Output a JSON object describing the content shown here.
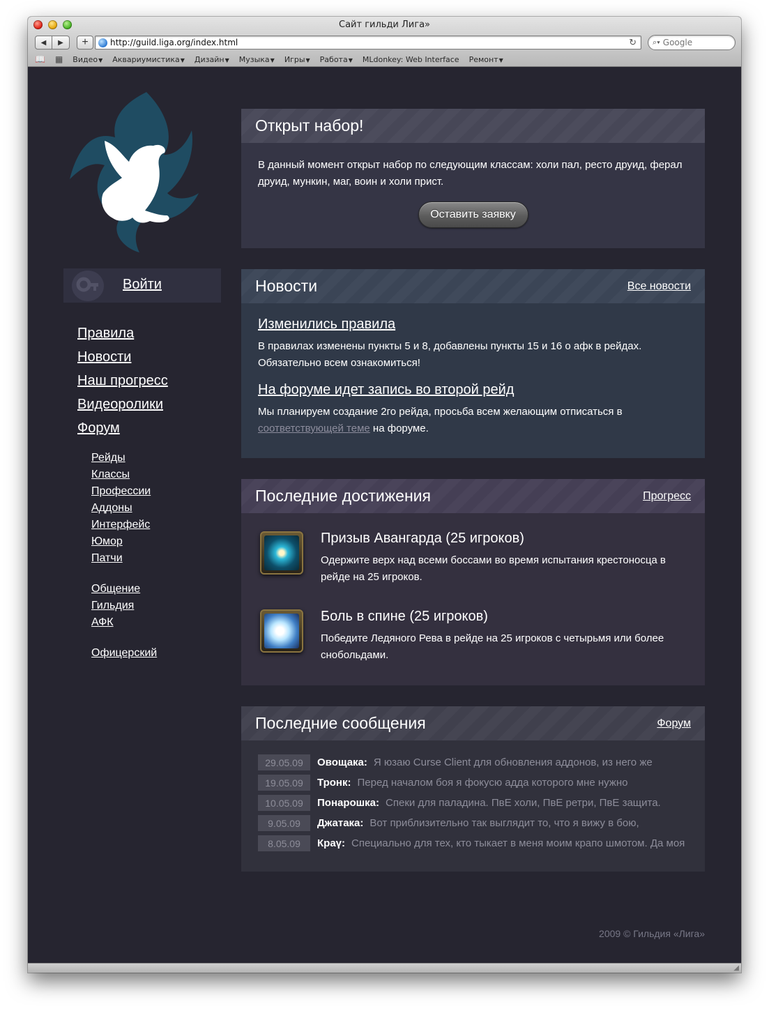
{
  "browser": {
    "window_title": "Сайт гильди Лига»",
    "url": "http://guild.liga.org/index.html",
    "search_placeholder": "Google",
    "bookmarks": [
      {
        "label": "Видео",
        "menu": true
      },
      {
        "label": "Аквариумистика",
        "menu": true
      },
      {
        "label": "Дизайн",
        "menu": true
      },
      {
        "label": "Музыка",
        "menu": true
      },
      {
        "label": "Игры",
        "menu": true
      },
      {
        "label": "Работа",
        "menu": true
      },
      {
        "label": "MLdonkey: Web Interface",
        "menu": false
      },
      {
        "label": "Ремонт",
        "menu": true
      }
    ]
  },
  "sidebar": {
    "login_label": "Войти",
    "main_nav": [
      "Правила",
      "Новости",
      "Наш прогресс",
      "Видеоролики",
      "Форум"
    ],
    "forum_sections": [
      [
        "Рейды",
        "Классы",
        "Профессии",
        "Аддоны",
        "Интерфейс",
        "Юмор",
        "Патчи"
      ],
      [
        "Общение",
        "Гильдия",
        "АФК"
      ],
      [
        "Офицерский"
      ]
    ]
  },
  "recruit": {
    "title": "Открыт набор!",
    "text": "В данный момент открыт набор по следующим классам: холи пал, ресто друид, ферал друид, мункин, маг, воин и холи прист.",
    "button": "Оставить заявку"
  },
  "news": {
    "title": "Новости",
    "all_link": "Все новости",
    "item1_title": "Изменились правила",
    "item1_text": "В правилах изменены пункты 5 и 8, добавлены пункты 15 и 16 о афк в рейдах. Обязательно всем ознакомиться!",
    "item2_title": "На форуме идет запись во второй рейд",
    "item2_text_before": "Мы планируем создание 2го рейда, просьба всем желающим отписаться в",
    "item2_link": "соответствующей теме",
    "item2_text_after": " на форуме."
  },
  "achievements": {
    "title": "Последние достижения",
    "link": "Прогресс",
    "item1_title": "Призыв Авангарда (25 игроков)",
    "item1_text": "Одержите верх над всеми боссами во время испытания крестоносца в рейде на 25 игроков.",
    "item2_title": "Боль в спине (25 игроков)",
    "item2_text": "Победите Ледяного Рева в рейде на 25 игроков с четырьмя или более снобольдами."
  },
  "messages": {
    "title": "Последние сообщения",
    "link": "Форум",
    "rows": [
      {
        "date": "29.05.09",
        "user": "Овощака:",
        "text": "Я юзаю Curse Client для обновления аддонов, из него же"
      },
      {
        "date": "19.05.09",
        "user": "Тронк:",
        "text": "Перед началом боя я фокусю адда которого мне нужно"
      },
      {
        "date": "10.05.09",
        "user": "Понарошка:",
        "text": "Спеки для паладина. ПвЕ холи, ПвЕ ретри, ПвЕ защита."
      },
      {
        "date": "9.05.09",
        "user": "Джатака:",
        "text": "Вот приблизительно так выглядит то, что я вижу в бою,"
      },
      {
        "date": "8.05.09",
        "user": "Краү:",
        "text": "Специально для тех, кто тыкает в меня моим крапо шмотом. Да моя"
      }
    ]
  },
  "footer": "2009 © Гильдия «Лига»",
  "colors": {
    "page_bg": "#262530",
    "panel": "#353545",
    "news_panel": "#303948",
    "achievements_panel": "#34303f",
    "logo_dragon": "#1f4c62"
  }
}
